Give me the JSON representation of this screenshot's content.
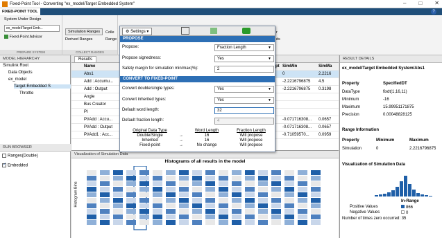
{
  "window": {
    "title": "Fixed-Point Tool - Converting \"ex_model/Target Embedded System\"",
    "min": "–",
    "max": "□",
    "close": "✕"
  },
  "tab": {
    "label": "FIXED-POINT TOOL",
    "help": "?"
  },
  "ribbon": {
    "sud_label": "System Under Design",
    "sud_value": "ex_model/Target Emb...",
    "advisor": "Fixed-Point Advisor",
    "prepare": "PREPARE SYSTEM",
    "sim_ranges": "Simulation Ranges",
    "derived_ranges": "Derived Ranges",
    "collect": "COLLECT RANGES",
    "col_frag": "Colle",
    "range_frag": "Range",
    "frag_r": "r",
    "frag_ds": "ds"
  },
  "left": {
    "hierarchy": "MODEL HIERARCHY",
    "tree": [
      "Simulink Root",
      "Data Objects",
      "ex_model",
      "Target Embedded S",
      "Throttle"
    ],
    "run_browser": "RUN BROWSER",
    "run_ranges": "Ranges(Double)",
    "run_embedded": "Embedded"
  },
  "results": {
    "tab": "Results",
    "headers": {
      "name": "Name",
      "spec": "pt",
      "simmin": "SimMin",
      "simmax": "SimMa"
    },
    "rows": [
      {
        "name": "Abs1",
        "simmin": "0",
        "simmax": "2.2216"
      },
      {
        "name": "Add : Accumu...",
        "simmin": "-2.2216796875",
        "simmax": "4.5"
      },
      {
        "name": "Add : Output",
        "simmin": "-2.2216796875",
        "simmax": "0.3198"
      },
      {
        "name": "Angle",
        "simmin": "",
        "simmax": ""
      },
      {
        "name": "Bus Creator",
        "simmin": "",
        "simmax": ""
      },
      {
        "name": "PI",
        "simmin": "",
        "simmax": ""
      },
      {
        "name": "PI/Add : Accu...",
        "simmin": "-0.071716308...",
        "simmax": "0.0657"
      },
      {
        "name": "PI/Add : Output",
        "simmin": "-0.071716308...",
        "simmax": "0.0657"
      },
      {
        "name": "PI/Add1 : Acc...",
        "simmin": "-0.71059570...",
        "simmax": "0.0959"
      }
    ],
    "vis_title": "Visualization of Simulation Data",
    "hist_title": "Histograms of all results in the model",
    "hist_ylabel": "Histogram Bins",
    "ticks": [
      "2^5",
      "2^1",
      "2^-3",
      "2^-7",
      "2^-11",
      "2^-15",
      "2^-19",
      "2^-23",
      "2^-27"
    ]
  },
  "details": {
    "header": "RESULT DETAILS",
    "path": "ex_model/Target Embedded System/Abs1",
    "prop_h": "Property",
    "spec_h": "SpecifiedDT",
    "props": [
      {
        "k": "DataType",
        "v": "fixdt(1,16,11)"
      },
      {
        "k": "Minimum",
        "v": "-16"
      },
      {
        "k": "Maximum",
        "v": "15.99951171875"
      },
      {
        "k": "Precision",
        "v": "0.00048828125"
      }
    ],
    "range_info": "Range Information",
    "rh": {
      "p": "Property",
      "min": "Minimum",
      "max": "Maximum"
    },
    "range_row": {
      "p": "Simulation",
      "min": "0",
      "max": "2.2216796875"
    },
    "vis_title": "Visualization of Simulation Data",
    "inrange": "In-Range",
    "pos": "Positive Values",
    "pos_n": "866",
    "neg": "Negative Values",
    "neg_n": "0",
    "zero": "Number of times zero occurred: 35"
  },
  "dialog": {
    "settings": "Settings",
    "propose_sec": "PROPOSE",
    "propose_lbl": "Propose:",
    "propose_val": "Fraction Length",
    "sign_lbl": "Propose signedness:",
    "sign_val": "Yes",
    "margin_lbl": "Safety margin for simulation min/max(%):",
    "margin_val": "2",
    "convert_sec": "CONVERT TO FIXED-POINT",
    "conv_lbl": "Convert double/single types:",
    "conv_val": "Yes",
    "inh_lbl": "Convert inherited types:",
    "inh_val": "Yes",
    "wl_lbl": "Default word length:",
    "wl_val": "32",
    "fl_lbl": "Default fraction length:",
    "fl_val": "4",
    "th": {
      "odt": "Original Data Type",
      "wl": "Word Length",
      "fl": "Fraction Length"
    },
    "trows": [
      {
        "odt": "Double/Single",
        "wl": "16",
        "fl": "Will propose"
      },
      {
        "odt": "Inherited",
        "wl": "16",
        "fl": "Will propose"
      },
      {
        "odt": "Fixed-point",
        "wl": "No change",
        "fl": "Will propose"
      }
    ],
    "arrow": "→"
  },
  "colors": {
    "accent": "#2d6fb5",
    "hist": "#1f5fa8"
  }
}
